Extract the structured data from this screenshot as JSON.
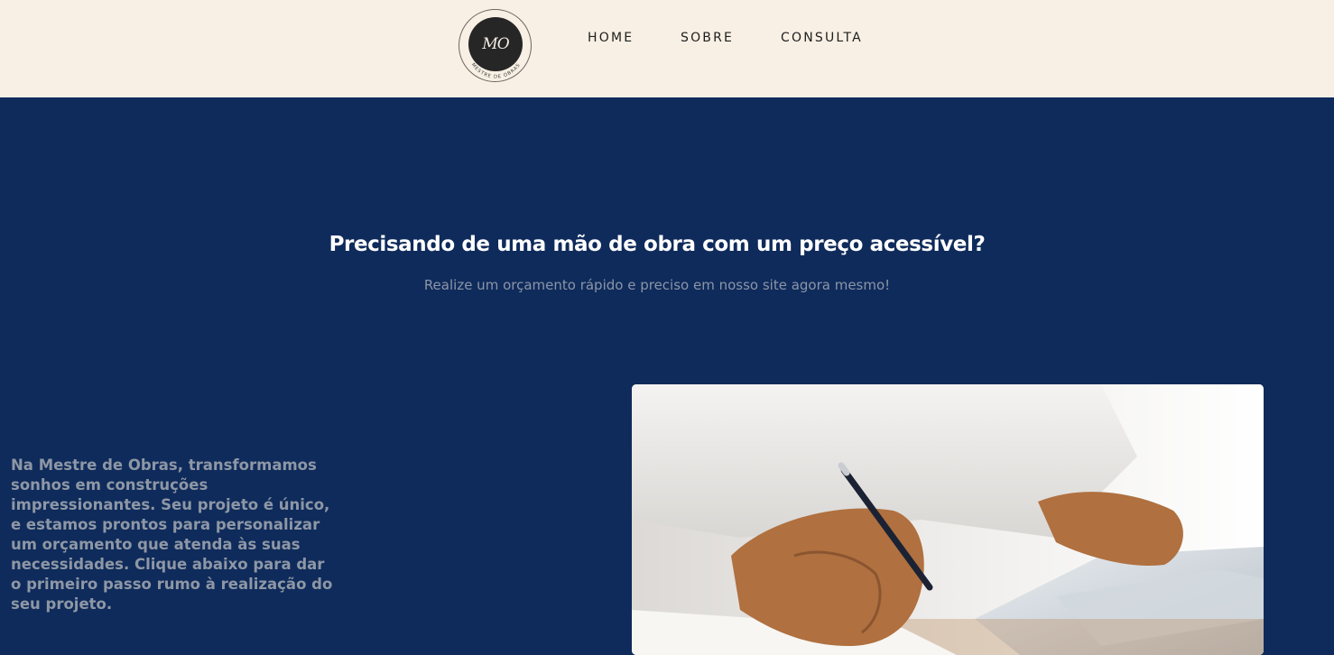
{
  "header": {
    "logo": {
      "initials": "MO",
      "ring_text": "MESTRE DE OBRAS"
    },
    "nav": [
      {
        "label": "HOME"
      },
      {
        "label": "SOBRE"
      },
      {
        "label": "CONSULTA"
      }
    ]
  },
  "hero": {
    "title": "Precisando de uma mão de obra com um preço acessível?",
    "subtitle": "Realize um orçamento rápido e preciso em nosso site agora mesmo!"
  },
  "about": {
    "text": "Na Mestre de Obras, transformamos sonhos em construções impressionantes. Seu projeto é único, e estamos prontos para personalizar um orçamento que atenda às suas necessidades. Clique abaixo para dar o primeiro passo rumo à realização do seu projeto."
  },
  "colors": {
    "header_bg": "#f8f0e4",
    "page_bg": "#0f2b5b",
    "title_text": "#ffffff",
    "muted_text": "#8b95a8"
  }
}
